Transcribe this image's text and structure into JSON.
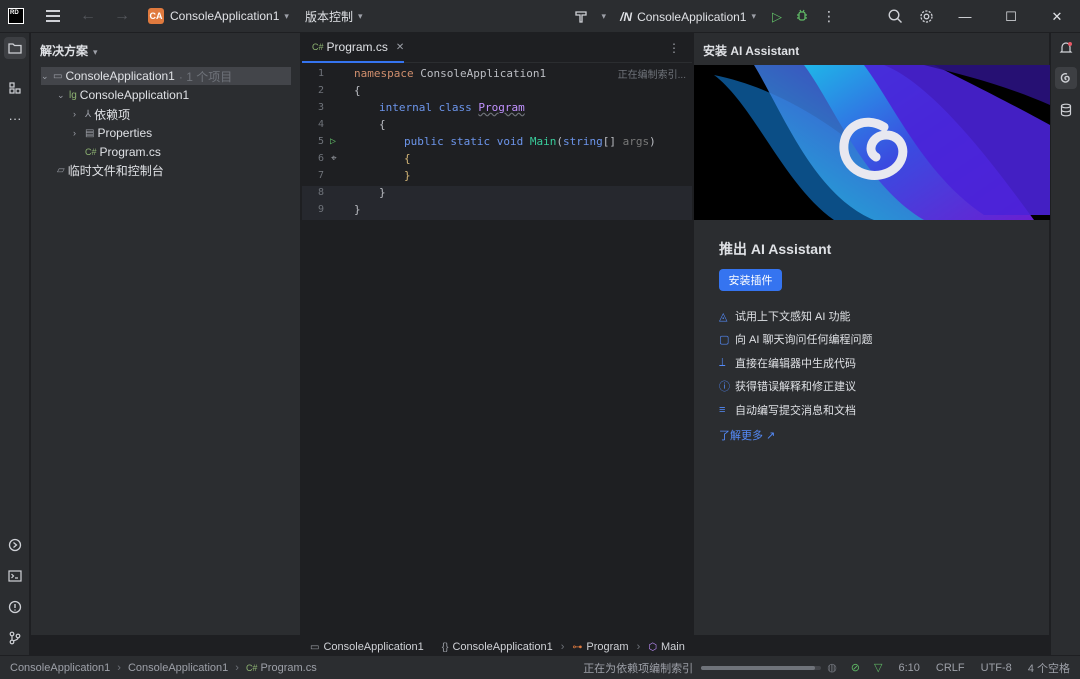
{
  "titlebar": {
    "project_badge": "CA",
    "project_name": "ConsoleApplication1",
    "vcs_label": "版本控制",
    "run_config": "ConsoleApplication1",
    "net_logo": "/N"
  },
  "solution": {
    "title": "解决方案",
    "items": [
      {
        "label": "ConsoleApplication1",
        "muted": "· 1 个项目"
      },
      {
        "label": "ConsoleApplication1"
      },
      {
        "label": "依赖项"
      },
      {
        "label": "Properties"
      },
      {
        "label": "Program.cs"
      },
      {
        "label": "临时文件和控制台"
      }
    ]
  },
  "editor": {
    "tab_label": "Program.cs",
    "tab_prefix": "C#",
    "hint": "正在编制索引...",
    "lines": {
      "l1": {
        "kw": "namespace",
        "name": "ConsoleApplication1"
      },
      "l2": "{",
      "l3": {
        "kw1": "internal",
        "kw2": "class",
        "name": "Program"
      },
      "l4": "{",
      "l5": {
        "kw1": "public",
        "kw2": "static",
        "kw3": "void",
        "method": "Main",
        "type": "string",
        "arr": "[]",
        "param": "args"
      },
      "l6": "{",
      "l7": "}",
      "l8": "}",
      "l9": "}"
    },
    "breadcrumb": [
      "ConsoleApplication1",
      "ConsoleApplication1",
      "Program",
      "Main"
    ]
  },
  "ai": {
    "header": "安装 AI Assistant",
    "title": "推出 AI Assistant",
    "install_label": "安装插件",
    "features": [
      "试用上下文感知 AI 功能",
      "向 AI 聊天询问任何编程问题",
      "直接在编辑器中生成代码",
      "获得错误解释和修正建议",
      "自动编写提交消息和文档"
    ],
    "learn_more": "了解更多 ↗"
  },
  "statusbar": {
    "path": [
      "ConsoleApplication1",
      "ConsoleApplication1",
      "Program.cs"
    ],
    "path_prefix": "C#",
    "indexing": "正在为依赖项编制索引",
    "progress": 0.95,
    "position": "6:10",
    "line_sep": "CRLF",
    "encoding": "UTF-8",
    "indent": "4 个空格"
  },
  "colors": {
    "accent": "#3574f0",
    "run": "#5fb865",
    "badge": "#e07a3e"
  }
}
